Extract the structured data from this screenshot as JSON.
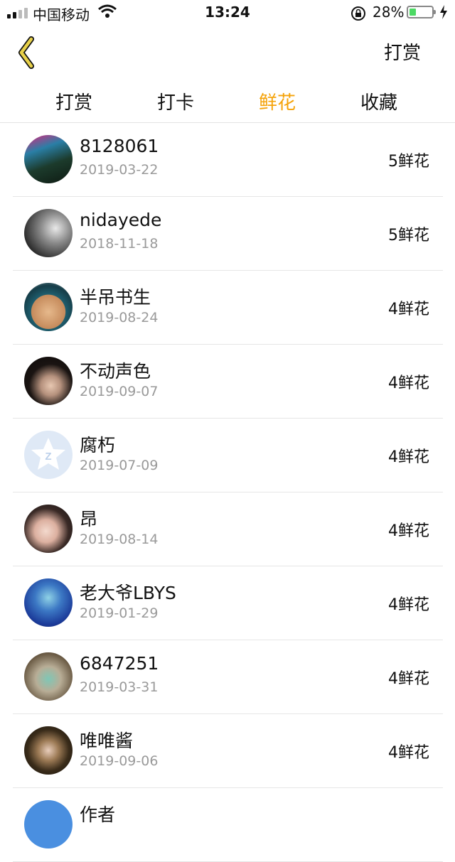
{
  "status": {
    "carrier": "中国移动",
    "time": "13:24",
    "battery_percent": "28%",
    "battery_level": 0.28
  },
  "nav": {
    "action": "打赏"
  },
  "tabs": [
    {
      "label": "打赏",
      "active": false
    },
    {
      "label": "打卡",
      "active": false
    },
    {
      "label": "鲜花",
      "active": true
    },
    {
      "label": "收藏",
      "active": false
    }
  ],
  "colors": {
    "accent": "#f5a30a",
    "back_icon": "#e8d14a",
    "divider": "#e6e6e6",
    "date_text": "#9a9a9a"
  },
  "list": [
    {
      "name": "8128061",
      "date": "2019-03-22",
      "count": "5鲜花"
    },
    {
      "name": "nidayede",
      "date": "2018-11-18",
      "count": "5鲜花"
    },
    {
      "name": "半吊书生",
      "date": "2019-08-24",
      "count": "4鲜花"
    },
    {
      "name": "不动声色",
      "date": "2019-09-07",
      "count": "4鲜花"
    },
    {
      "name": "腐朽",
      "date": "2019-07-09",
      "count": "4鲜花"
    },
    {
      "name": "昂",
      "date": "2019-08-14",
      "count": "4鲜花"
    },
    {
      "name": "老大爷LBYS",
      "date": "2019-01-29",
      "count": "4鲜花"
    },
    {
      "name": "6847251",
      "date": "2019-03-31",
      "count": "4鲜花"
    },
    {
      "name": "唯唯酱",
      "date": "2019-09-06",
      "count": "4鲜花"
    },
    {
      "name": "作者",
      "date": "",
      "count": ""
    }
  ]
}
